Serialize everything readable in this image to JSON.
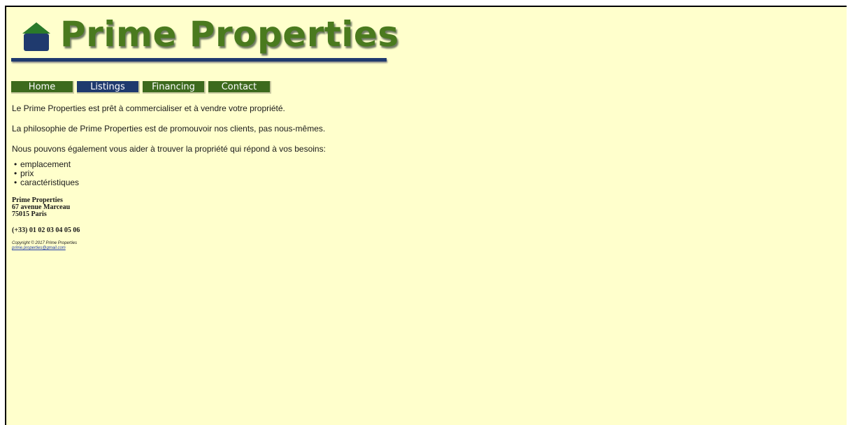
{
  "logo": {
    "title": "Prime Properties",
    "icon": "house-icon",
    "colors": {
      "text": "#4a7a1e",
      "icon": "#1f3a6e",
      "underline": "#1f3a6e"
    }
  },
  "nav": {
    "items": [
      {
        "label": "Home",
        "active": false
      },
      {
        "label": "Listings",
        "active": true
      },
      {
        "label": "Financing",
        "active": false
      },
      {
        "label": "Contact",
        "active": false
      }
    ],
    "colors": {
      "normal": "#3d6a1d",
      "active": "#1f3a6e"
    }
  },
  "content": {
    "paragraphs": [
      "Le Prime Properties est prêt à commercialiser et à vendre votre propriété.",
      "La philosophie de Prime Properties est de promouvoir nos clients, pas nous-mêmes.",
      "Nous pouvons également vous aider à trouver la propriété qui répond à vos besoins:"
    ],
    "list": [
      "emplacement",
      "prix",
      "caractéristiques"
    ]
  },
  "address": {
    "name": "Prime Properties",
    "street": "67 avenue Marceau",
    "city": "75015 Paris",
    "phone": "(+33) 01 02 03 04 05 06"
  },
  "footer": {
    "copyright": "Copyright © 2017 Prime Properties",
    "email": "prime.properties@gmail.com"
  },
  "page": {
    "background": "#ffffcc"
  }
}
